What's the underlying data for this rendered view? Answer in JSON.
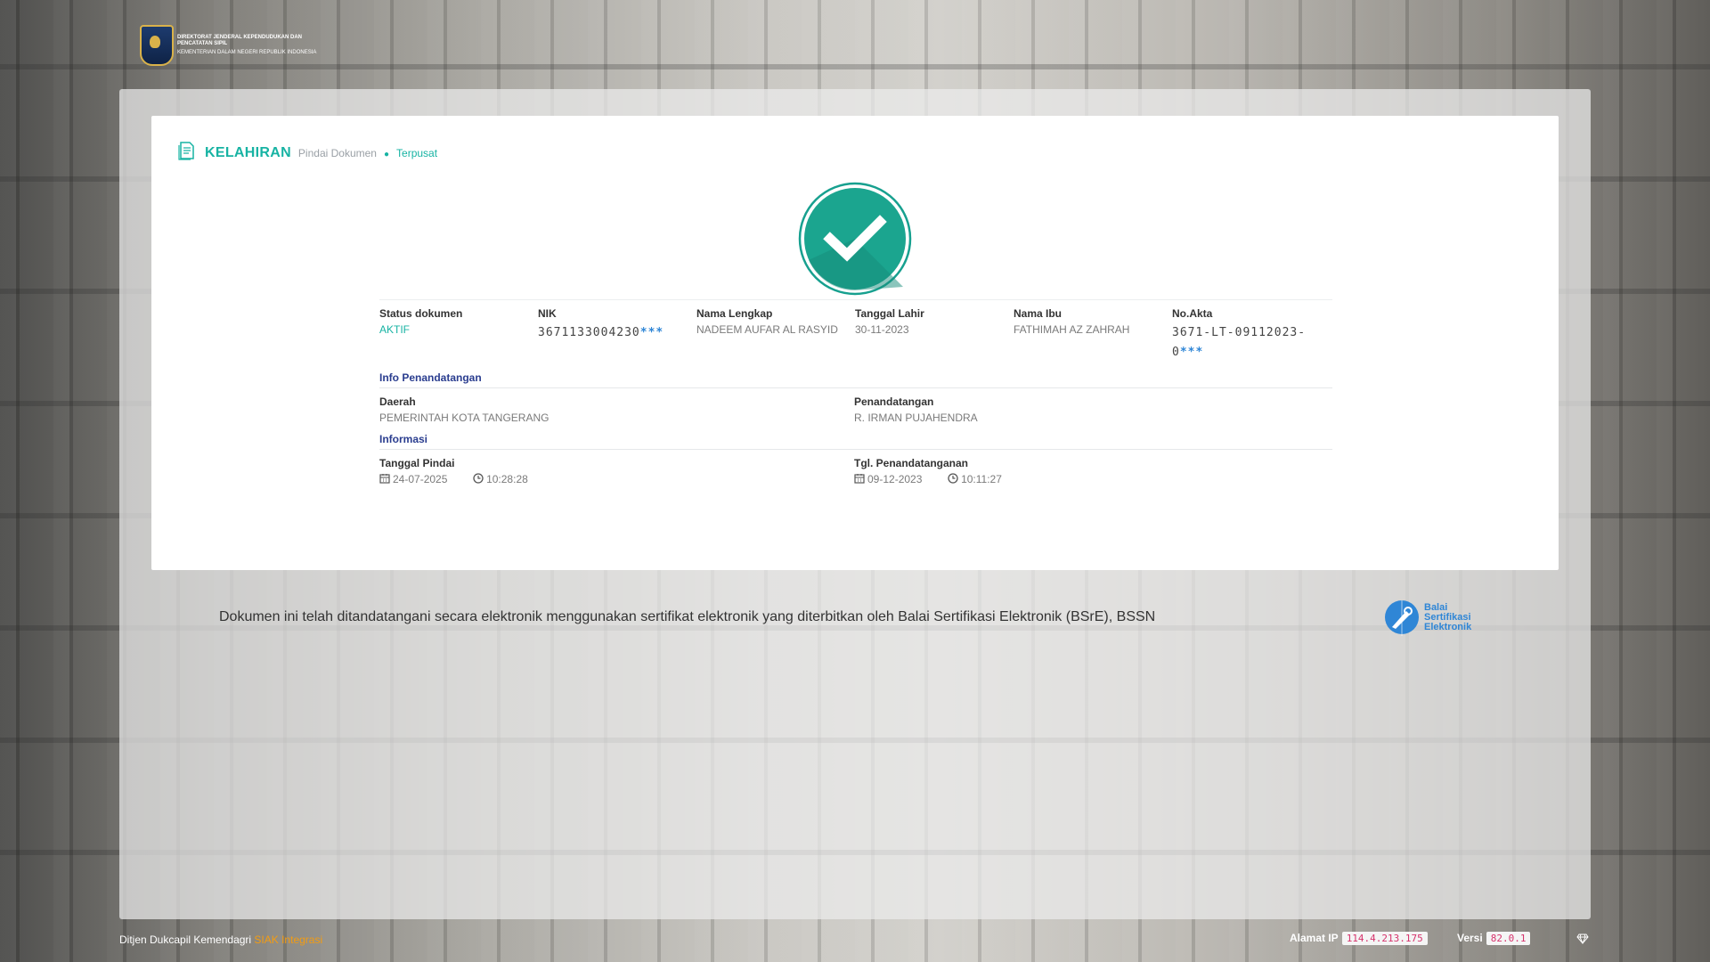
{
  "header": {
    "logo_line1": "DIREKTORAT JENDERAL KEPENDUDUKAN DAN",
    "logo_line2": "PENCATATAN SIPIL",
    "logo_line3": "KEMENTERIAN DALAM NEGERI REPUBLIK INDONESIA"
  },
  "card": {
    "title": "KELAHIRAN",
    "subtitle": "Pindai Dokumen",
    "subtitle_active": "Terpusat",
    "status_icon": "check-circle-icon"
  },
  "document": {
    "fields": [
      {
        "label": "Status dokumen",
        "value": "AKTIF"
      },
      {
        "label": "NIK",
        "value": "3671133004230",
        "masked": "***"
      },
      {
        "label": "Nama Lengkap",
        "value": "NADEEM AUFAR AL RASYID"
      },
      {
        "label": "Tanggal Lahir",
        "value": "30-11-2023"
      },
      {
        "label": "Nama Ibu",
        "value": "FATHIMAH AZ ZAHRAH"
      },
      {
        "label": "No.Akta",
        "value": "3671-LT-09112023-0",
        "masked": "***"
      }
    ]
  },
  "signing_info": {
    "section_title": "Info Penandatangan",
    "region_label": "Daerah",
    "region_value": "PEMERINTAH KOTA TANGERANG",
    "signer_label": "Penandatangan",
    "signer_value": "R. IRMAN PUJAHENDRA"
  },
  "information": {
    "section_title": "Informasi",
    "scan_label": "Tanggal Pindai",
    "scan_date": "24-07-2025",
    "scan_time": "10:28:28",
    "sign_label": "Tgl. Penandatanganan",
    "sign_date": "09-12-2023",
    "sign_time": "10:11:27"
  },
  "notice": "Dokumen ini telah ditandatangani secara elektronik menggunakan sertifikat elektronik yang diterbitkan oleh Balai Sertifikasi Elektronik (BSrE), BSSN",
  "bsre_logo": {
    "line1": "Balai",
    "line2": "Sertifikasi",
    "line3": "Elektronik"
  },
  "footer": {
    "org": "Ditjen Dukcapil Kemendagri",
    "app": "SIAK Integrasi",
    "ip_label": "Alamat IP",
    "ip_value": "114.4.213.175",
    "version_label": "Versi",
    "version_value": "82.0.1"
  },
  "colors": {
    "accent": "#17b3a3",
    "section": "#2a3d8f",
    "mask": "#2f86d6",
    "footer_highlight": "#f39c12"
  }
}
